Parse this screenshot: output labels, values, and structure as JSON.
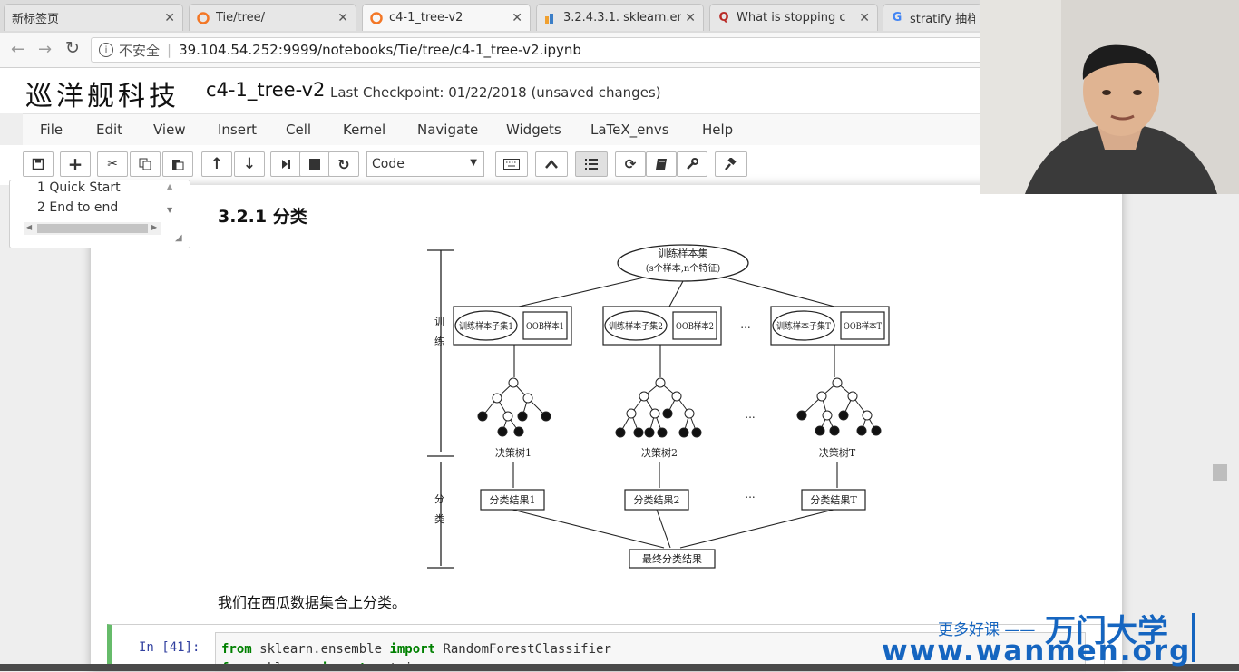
{
  "browser": {
    "tabs": [
      {
        "label": "新标签页",
        "icon": "blank-page-icon",
        "active": false
      },
      {
        "label": "Tie/tree/",
        "icon": "jupyter-icon",
        "active": false
      },
      {
        "label": "c4-1_tree-v2",
        "icon": "jupyter-icon",
        "active": true
      },
      {
        "label": "3.2.4.3.1. sklearn.en",
        "icon": "sklearn-icon",
        "active": false
      },
      {
        "label": "What is stopping c",
        "icon": "quora-icon",
        "active": false
      },
      {
        "label": "stratify 抽样",
        "icon": "google-icon",
        "active": false
      }
    ],
    "security_label": "不安全",
    "url": "39.104.54.252:9999/notebooks/Tie/tree/c4-1_tree-v2.ipynb"
  },
  "header": {
    "logo_text": "巡洋舰科技",
    "notebook_name": "c4-1_tree-v2",
    "checkpoint": "Last Checkpoint: 01/22/2018 (unsaved changes)"
  },
  "menu": [
    "File",
    "Edit",
    "View",
    "Insert",
    "Cell",
    "Kernel",
    "Navigate",
    "Widgets",
    "LaTeX_envs",
    "Help"
  ],
  "toolbar": {
    "cell_type": "Code",
    "buttons": [
      "save-icon",
      "plus-icon",
      "cut-icon",
      "copy-icon",
      "paste-icon",
      "arrow-up-icon",
      "arrow-down-icon",
      "run-icon",
      "stop-icon",
      "restart-icon",
      "keyboard-icon",
      "caret-up-icon",
      "list-icon",
      "refresh-icon",
      "book-icon",
      "wrench-icon",
      "gavel-icon"
    ]
  },
  "toc": {
    "items": [
      {
        "num": "1",
        "label": "Quick Start"
      },
      {
        "num": "2",
        "label": "End to end"
      }
    ]
  },
  "notebook": {
    "heading": "3.2.1  分类",
    "paragraph": "我们在西瓜数据集合上分类。",
    "cell_prompt": "In  [41]:",
    "code_line1_kw1": "from",
    "code_line1_mod": " sklearn.ensemble ",
    "code_line1_kw2": "import",
    "code_line1_name": " RandomForestClassifier",
    "code_line2_kw1": "from",
    "code_line2_mod": " sklearn ",
    "code_line2_kw2": "import",
    "code_line2_name": " metrics"
  },
  "diagram": {
    "root_line1": "训练样本集",
    "root_line2": "(s个样本,n个特征)",
    "side_train": "训练",
    "side_classify": "分类",
    "subset_labels": [
      "训练样本子集1",
      "训练样本子集2",
      "训练样本子集T"
    ],
    "oob_labels": [
      "OOB样本1",
      "OOB样本2",
      "OOB样本T"
    ],
    "tree_labels": [
      "决策树1",
      "决策树2",
      "决策树T"
    ],
    "result_labels": [
      "分类结果1",
      "分类结果2",
      "分类结果T"
    ],
    "final_label": "最终分类结果",
    "ellipsis": "..."
  },
  "watermark": {
    "slogan": "更多好课 ——",
    "brand": "万门大学",
    "url": "www.wanmen.org"
  }
}
